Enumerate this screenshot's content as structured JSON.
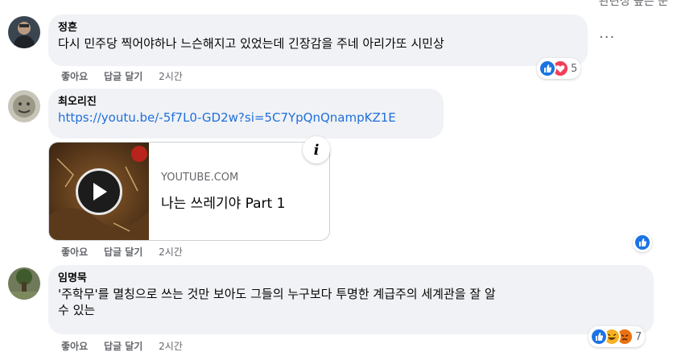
{
  "top_partial": "관련성 높은 순",
  "comments": [
    {
      "author": "정흔",
      "text": "다시 민주당 찍어야하나 느슨해지고 있었는데 긴장감을 주네 아리가또 시민상",
      "like_label": "좋아요",
      "reply_label": "답글 달기",
      "time": "2시간",
      "reaction_icons": [
        "like-icon",
        "love-icon"
      ],
      "reaction_count": "5",
      "more_label": "···"
    },
    {
      "author": "최오리진",
      "link_text": "https://youtu.be/-5f7L0-GD2w?si=5C7YpQnQnampKZ1E",
      "preview": {
        "domain": "YOUTUBE.COM",
        "title": "나는 쓰레기야 Part 1",
        "info_glyph": "i"
      },
      "like_label": "좋아요",
      "reply_label": "답글 달기",
      "time": "2시간",
      "reaction_icons": [
        "like-icon"
      ]
    },
    {
      "author": "임명묵",
      "text_line1": "'주학무'를 멸칭으로 쓰는 것만 보아도 그들의 누구보다 투명한 계급주의 세계관을 잘 알",
      "text_line2": "수 있는",
      "like_label": "좋아요",
      "reply_label": "답글 달기",
      "time": "2시간",
      "reaction_icons": [
        "like-icon",
        "haha-icon",
        "angry-icon"
      ],
      "reaction_count": "7"
    }
  ],
  "colors": {
    "bubble": "#f0f2f5",
    "link": "#216fdb",
    "secondary_text": "#65676b",
    "like_blue": "#1b74e4",
    "love_red": "#f33e58",
    "haha_yellow": "#f7b125",
    "angry_orange": "#e9710f"
  }
}
